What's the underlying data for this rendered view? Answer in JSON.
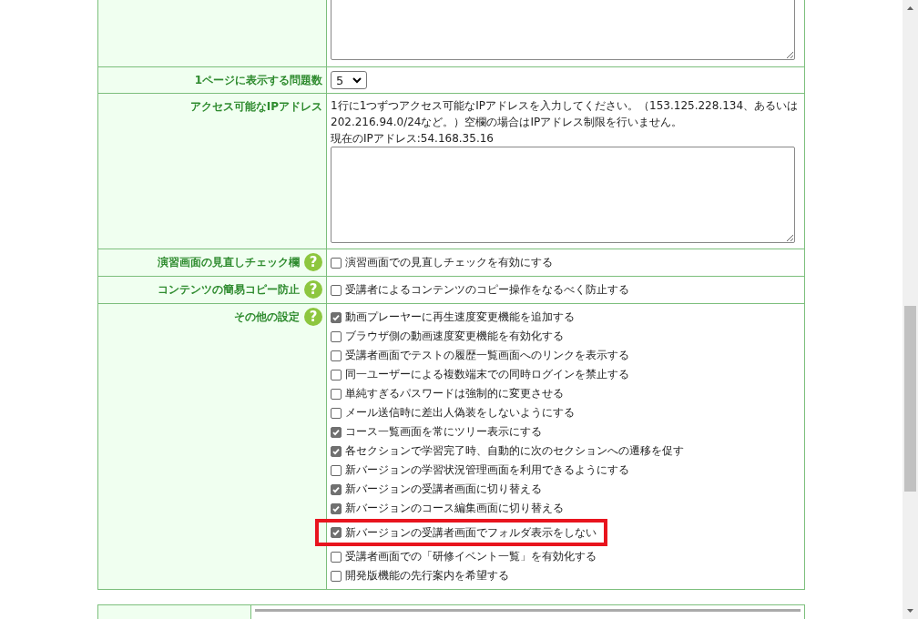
{
  "settings": [
    {
      "kind": "textarea"
    },
    {
      "kind": "select",
      "label": "1ページに表示する問題数",
      "value": "5"
    },
    {
      "kind": "ip",
      "label": "アクセス可能なIPアドレス",
      "note": "1行に1つずつアクセス可能なIPアドレスを入力してください。（153.125.228.134、あるいは202.216.94.0/24など。）空欄の場合はIPアドレス制限を行いません。",
      "current": "現在のIPアドレス:54.168.35.16"
    },
    {
      "kind": "checks",
      "label": "演習画面の見直しチェック欄",
      "help": "?",
      "options": [
        {
          "text": "演習画面での見直しチェックを有効にする",
          "checked": false,
          "highlighted": false
        }
      ]
    },
    {
      "kind": "checks",
      "label": "コンテンツの簡易コピー防止",
      "help": "?",
      "options": [
        {
          "text": "受講者によるコンテンツのコピー操作をなるべく防止する",
          "checked": false,
          "highlighted": false
        }
      ]
    },
    {
      "kind": "checks",
      "label": "その他の設定",
      "help": "?",
      "options": [
        {
          "text": "動画プレーヤーに再生速度変更機能を追加する",
          "checked": true,
          "highlighted": false
        },
        {
          "text": "ブラウザ側の動画速度変更機能を有効化する",
          "checked": false,
          "highlighted": false
        },
        {
          "text": "受講者画面でテストの履歴一覧画面へのリンクを表示する",
          "checked": false,
          "highlighted": false
        },
        {
          "text": "同一ユーザーによる複数端末での同時ログインを禁止する",
          "checked": false,
          "highlighted": false
        },
        {
          "text": "単純すぎるパスワードは強制的に変更させる",
          "checked": false,
          "highlighted": false
        },
        {
          "text": "メール送信時に差出人偽装をしないようにする",
          "checked": false,
          "highlighted": false
        },
        {
          "text": "コース一覧画面を常にツリー表示にする",
          "checked": true,
          "highlighted": false
        },
        {
          "text": "各セクションで学習完了時、自動的に次のセクションへの遷移を促す",
          "checked": true,
          "highlighted": false
        },
        {
          "text": "新バージョンの学習状況管理画面を利用できるようにする",
          "checked": false,
          "highlighted": false
        },
        {
          "text": "新バージョンの受講者画面に切り替える",
          "checked": true,
          "highlighted": false
        },
        {
          "text": "新バージョンのコース編集画面に切り替える",
          "checked": true,
          "highlighted": false
        },
        {
          "text": "新バージョンの受講者画面でフォルダ表示をしない",
          "checked": true,
          "highlighted": true
        },
        {
          "text": "受講者画面での「研修イベント一覧」を有効化する",
          "checked": false,
          "highlighted": false
        },
        {
          "text": "開発版機能の先行案内を希望する",
          "checked": false,
          "highlighted": false
        }
      ]
    }
  ]
}
